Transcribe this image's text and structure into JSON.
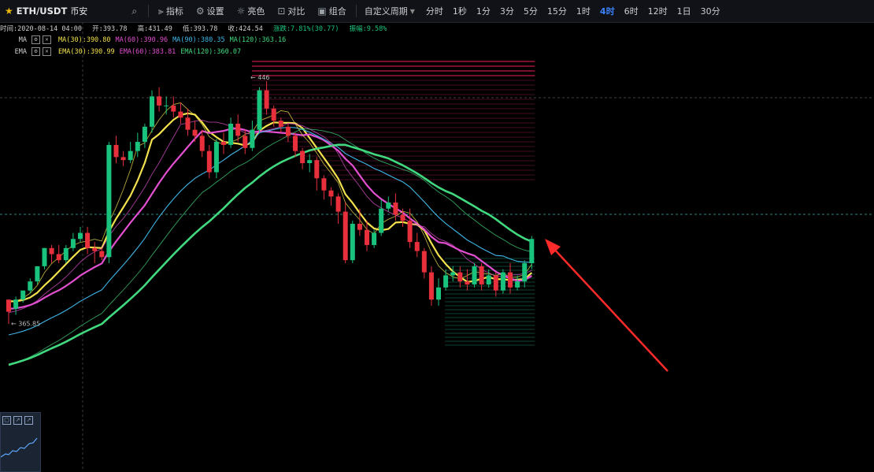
{
  "toolbar": {
    "symbol": "ETH/USDT",
    "exchange": "币安",
    "items": [
      {
        "label": "指标",
        "icon": "indicator-icon"
      },
      {
        "label": "设置",
        "icon": "gear-icon"
      },
      {
        "label": "亮色",
        "icon": "sun-icon"
      },
      {
        "label": "对比",
        "icon": "compare-icon"
      },
      {
        "label": "组合",
        "icon": "combine-icon"
      }
    ],
    "custom_period": "自定义周期",
    "timeframes": [
      "分时",
      "1秒",
      "1分",
      "3分",
      "5分",
      "15分",
      "1时",
      "4时",
      "6时",
      "12时",
      "1日",
      "30分"
    ],
    "active_timeframe": "4时"
  },
  "ohlc": {
    "time": "时间:2020-08-14 04:00",
    "open": "开:393.78",
    "high": "高:431.49",
    "low": "低:393.78",
    "close": "收:424.54",
    "change": "涨跌:7.81%(30.77)",
    "amplitude": "振幅:9.58%"
  },
  "indicators": {
    "ma": {
      "name": "MA",
      "values": [
        {
          "label": "MA(30):390.80",
          "color": "#f2e14c"
        },
        {
          "label": "MA(60):390.96",
          "color": "#e24fd0"
        },
        {
          "label": "MA(90):380.35",
          "color": "#3fb7e8"
        },
        {
          "label": "MA(120):363.16",
          "color": "#41d97f"
        }
      ]
    },
    "ema": {
      "name": "EMA",
      "values": [
        {
          "label": "EMA(30):390.99",
          "color": "#f2e14c"
        },
        {
          "label": "EMA(60):383.81",
          "color": "#e24fd0"
        },
        {
          "label": "EMA(120):360.07",
          "color": "#41d97f"
        }
      ]
    }
  },
  "chart_data": {
    "type": "candlestick",
    "symbol": "ETH/USDT",
    "interval": "4h",
    "annotations": {
      "max_label": "← 446",
      "max_value": 446,
      "min_label": "← 365.85",
      "min_value": 365.85
    },
    "ylim": [
      346,
      452
    ],
    "colors": {
      "up": "#19c37d",
      "down": "#e8303d",
      "ma30": "#f2e14c",
      "ma60": "#e24fd0",
      "ma90": "#3fb7e8",
      "ma120": "#41d97f",
      "arrow": "#ff2a2a"
    },
    "candles": [
      [
        374,
        374,
        370,
        366
      ],
      [
        371,
        375,
        374,
        369
      ],
      [
        374,
        377,
        377,
        373
      ],
      [
        377,
        381,
        380,
        376
      ],
      [
        380,
        385,
        385,
        379
      ],
      [
        385,
        391,
        391,
        384
      ],
      [
        391,
        392,
        389,
        386
      ],
      [
        389,
        392,
        387,
        386
      ],
      [
        387,
        392,
        391,
        386
      ],
      [
        391,
        396,
        394,
        390
      ],
      [
        394,
        398,
        396,
        393
      ],
      [
        396,
        398,
        391,
        389
      ],
      [
        391,
        393,
        390,
        386
      ],
      [
        390,
        391,
        388,
        387
      ],
      [
        388,
        426,
        425,
        386
      ],
      [
        425,
        428,
        421,
        419
      ],
      [
        421,
        423,
        420,
        418
      ],
      [
        420,
        426,
        423,
        419
      ],
      [
        423,
        429,
        426,
        421
      ],
      [
        426,
        432,
        431,
        424
      ],
      [
        431,
        443,
        441,
        429
      ],
      [
        441,
        444,
        438,
        436
      ],
      [
        438,
        441,
        438,
        435
      ],
      [
        438,
        441,
        436,
        434
      ],
      [
        436,
        439,
        434,
        432
      ],
      [
        434,
        437,
        430,
        428
      ],
      [
        430,
        433,
        428,
        426
      ],
      [
        428,
        430,
        423,
        421
      ],
      [
        423,
        425,
        416,
        414
      ],
      [
        416,
        427,
        426,
        414
      ],
      [
        426,
        429,
        425,
        422
      ],
      [
        425,
        434,
        432,
        424
      ],
      [
        432,
        435,
        428,
        426
      ],
      [
        428,
        430,
        424,
        422
      ],
      [
        424,
        433,
        430,
        423
      ],
      [
        430,
        444,
        443,
        429
      ],
      [
        443,
        446,
        437,
        435
      ],
      [
        437,
        438,
        433,
        431
      ],
      [
        433,
        434,
        431,
        429
      ],
      [
        431,
        432,
        428,
        426
      ],
      [
        428,
        429,
        423,
        421
      ],
      [
        423,
        424,
        419,
        417
      ],
      [
        419,
        422,
        420,
        416
      ],
      [
        420,
        421,
        414,
        410
      ],
      [
        414,
        415,
        410,
        407
      ],
      [
        410,
        411,
        408,
        405
      ],
      [
        408,
        409,
        403,
        399
      ],
      [
        403,
        406,
        387,
        386
      ],
      [
        387,
        400,
        399,
        386
      ],
      [
        399,
        404,
        397,
        395
      ],
      [
        397,
        400,
        392,
        390
      ],
      [
        392,
        397,
        396,
        391
      ],
      [
        396,
        407,
        404,
        395
      ],
      [
        404,
        408,
        406,
        403
      ],
      [
        406,
        409,
        402,
        400
      ],
      [
        402,
        404,
        400,
        398
      ],
      [
        400,
        404,
        393,
        391
      ],
      [
        393,
        396,
        390,
        388
      ],
      [
        390,
        391,
        383,
        381
      ],
      [
        383,
        385,
        374,
        372
      ],
      [
        374,
        381,
        378,
        372
      ],
      [
        378,
        384,
        382,
        377
      ],
      [
        382,
        385,
        383,
        380
      ],
      [
        383,
        385,
        380,
        378
      ],
      [
        380,
        384,
        379,
        377
      ],
      [
        379,
        386,
        385,
        378
      ],
      [
        385,
        386,
        379,
        377
      ],
      [
        379,
        384,
        382,
        378
      ],
      [
        382,
        383,
        377,
        375
      ],
      [
        377,
        384,
        383,
        376
      ],
      [
        383,
        386,
        378,
        376
      ],
      [
        378,
        382,
        380,
        377
      ],
      [
        380,
        387,
        386,
        378
      ],
      [
        386,
        395,
        394,
        384
      ]
    ]
  },
  "arrow": {
    "note": ""
  }
}
